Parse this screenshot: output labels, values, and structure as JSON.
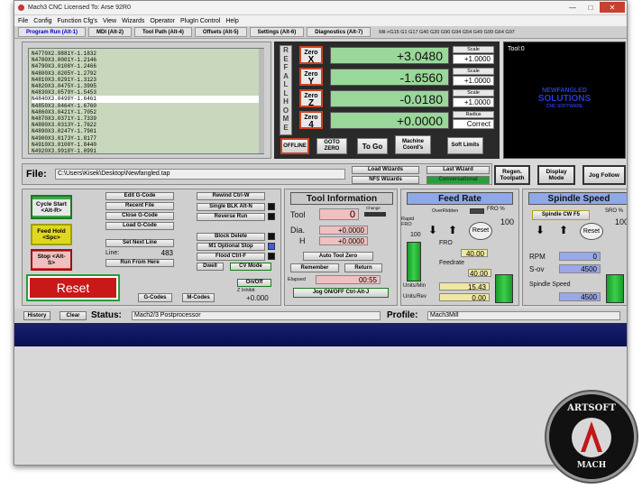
{
  "window": {
    "title": "Mach3 CNC  Licensed To: Arse 92R0"
  },
  "menu": [
    "File",
    "Config",
    "Function Cfg's",
    "View",
    "Wizards",
    "Operator",
    "PlugIn Control",
    "Help"
  ],
  "tabs": [
    "Program Run (Alt-1)",
    "MDI (Alt-2)",
    "Tool Path (Alt-4)",
    "Offsets (Alt-5)",
    "Settings (Alt-6)",
    "Diagnostics (Alt-7)"
  ],
  "modal_gcodes": "Mil->G15  G1 G17 G40 G20 G90 G94 G54 G49 G99 G64 G97",
  "gcode_lines": [
    "N4770X2.9881Y-1.1832",
    "N4780X3.0001Y-1.2146",
    "N4790X3.0108Y-1.2466",
    "N4800X3.0205Y-1.2792",
    "N4810X3.0291Y-1.3123",
    "N4820X3.0475Y-1.3995",
    "N4830X3.0579Y-1.5453",
    "N4840X3.0498Y-1.6461",
    "N4850X3.0464Y-1.6760",
    "N4860X3.0421Y-1.7052",
    "N4870X3.0371Y-1.7339",
    "N4880X3.0313Y-1.7622",
    "N4890X3.0247Y-1.7901",
    "N4900X3.0173Y-1.8177",
    "N4910X3.0100Y-1.8440",
    "N4920X3.9918Y-1.8991"
  ],
  "ref_all_home": [
    "R",
    "E",
    "F",
    "A",
    "L",
    "L",
    "H",
    "O",
    "M",
    "E"
  ],
  "axes": [
    {
      "zero_label": "Zero",
      "axis": "X",
      "value": "+3.0480",
      "scale_label": "Scale",
      "scale": "+1.0000"
    },
    {
      "zero_label": "Zero",
      "axis": "Y",
      "value": "-1.6560",
      "scale_label": "Scale",
      "scale": "+1.0000"
    },
    {
      "zero_label": "Zero",
      "axis": "Z",
      "value": "-0.0180",
      "scale_label": "Scale",
      "scale": "+1.0000"
    },
    {
      "zero_label": "Zero",
      "axis": "4",
      "value": "+0.0000",
      "scale_label": "Radius",
      "scale": "Correct"
    }
  ],
  "dro_buttons": {
    "offline": "OFFLINE",
    "goto_zero": "GOTO ZERO",
    "to_go": "To Go",
    "machine_coords": "Machine Coord's",
    "soft_limits": "Soft Limits"
  },
  "toolview": {
    "label": "Tool:0",
    "logo_line1": "NEWFANGLED",
    "logo_line2": "SOLUTIONS",
    "logo_line3": "CNC SOFTWARE"
  },
  "file": {
    "label": "File:",
    "path": "C:\\Users\\Kisek\\Desktop\\Newfangled.tap"
  },
  "wizards": {
    "load": "Load Wizards",
    "last": "Last Wizard",
    "nfs": "NFS Wizards",
    "conversational": "Conversational"
  },
  "view_buttons": {
    "regen": "Regen. Toolpath",
    "display_mode": "Display Mode",
    "jog_follow": "Jog Follow"
  },
  "program_controls": {
    "cycle_start": "Cycle Start <Alt-R>",
    "feed_hold": "Feed Hold <Spc>",
    "stop": "Stop <Alt-S>",
    "reset": "Reset",
    "edit_gcode": "Edit G-Code",
    "recent_file": "Recent File",
    "close_gcode": "Close G-Code",
    "load_gcode": "Load G-Code",
    "set_next_line": "Set Next Line",
    "line_label": "Line:",
    "line_value": "483",
    "run_from_here": "Run From Here",
    "rewind": "Rewind Ctrl-W",
    "single_blk": "Single BLK Alt-N",
    "reverse_run": "Reverse Run",
    "block_delete": "Block Delete",
    "m1_optional": "M1 Optional Stop",
    "flood": "Flood Ctrl-F",
    "dwell": "Dwell",
    "cv_mode": "CV Mode",
    "on_off": "On/Off",
    "z_inhibit": "Z Inhibit",
    "z_inhibit_value": "+0.000",
    "gcodes": "G-Codes",
    "mcodes": "M-Codes"
  },
  "tool_info": {
    "header": "Tool Information",
    "tool_label": "Tool",
    "tool_value": "0",
    "change_label": "Change",
    "dia_label": "Dia.",
    "dia_value": "+0.0000",
    "h_label": "H",
    "h_value": "+0.0000",
    "auto_zero": "Auto Tool Zero",
    "remember": "Remember",
    "return": "Return",
    "elapsed_label": "Elapsed",
    "elapsed_value": "00:55",
    "jog": "Jog ON/OFF Ctrl-Alt-J"
  },
  "feed_rate": {
    "header": "Feed Rate",
    "overridden": "OverRidden",
    "fro_pct_label": "FRO %",
    "fro_pct": "100",
    "rapid_label": "Rapid FRO",
    "rapid_value": "100",
    "reset": "Reset",
    "fro_label": "FRO",
    "fro_value": "40.00",
    "feedrate_label": "Feedrate",
    "feedrate_value": "40.00",
    "units_min_label": "Units/Min",
    "units_min_value": "15.43",
    "units_rev_label": "Units/Rev",
    "units_rev_value": "0.00"
  },
  "spindle": {
    "header": "Spindle Speed",
    "cw_button": "Spindle CW F5",
    "sro_label": "SRO %",
    "sro_value": "100",
    "reset": "Reset",
    "rpm_label": "RPM",
    "rpm_value": "0",
    "sov_label": "S-ov",
    "sov_value": "4500",
    "speed_label": "Spindle Speed",
    "speed_value": "4500"
  },
  "status": {
    "history": "History",
    "clear": "Clear",
    "status_label": "Status:",
    "status_value": "Mach2/3 Postprocessor",
    "profile_label": "Profile:",
    "profile_value": "Mach3Mill"
  },
  "logo": {
    "top": "ARTSOFT",
    "bottom": "MACH"
  }
}
